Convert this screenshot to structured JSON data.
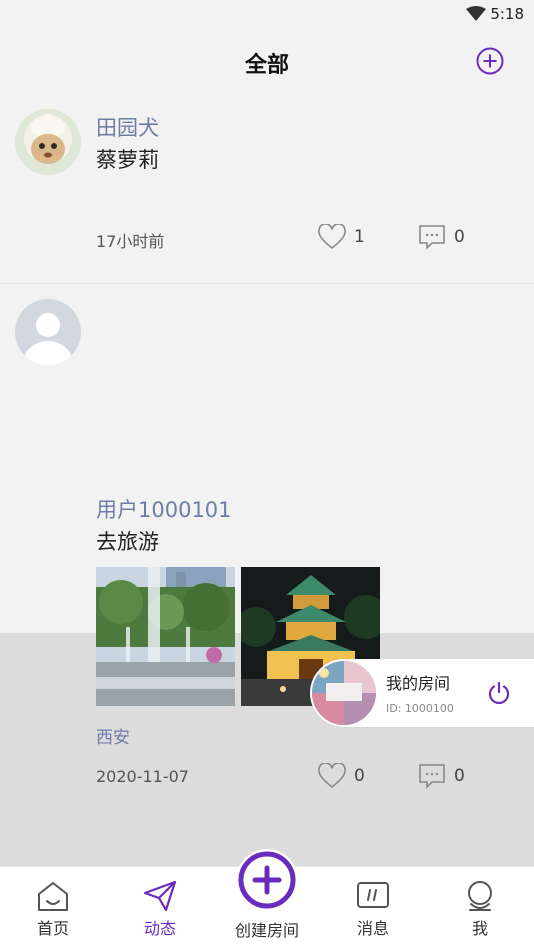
{
  "status_bar": {
    "time": "5:18"
  },
  "header": {
    "title": "全部"
  },
  "posts": [
    {
      "username": "田园犬",
      "content": "蔡萝莉",
      "time": "17小时前",
      "likes": "1",
      "comments": "0"
    },
    {
      "username": "用户1000101",
      "content": "去旅游",
      "location": "西安",
      "time": "2020-11-07",
      "likes": "0",
      "comments": "0"
    }
  ],
  "room": {
    "title": "我的房间",
    "id": "ID: 1000100"
  },
  "tabs": {
    "home": "首页",
    "feed": "动态",
    "create": "创建房间",
    "messages": "消息",
    "me": "我"
  },
  "colors": {
    "accent": "#6a2bbf",
    "link": "#6c7ea6",
    "background": "#f2f2f2"
  }
}
